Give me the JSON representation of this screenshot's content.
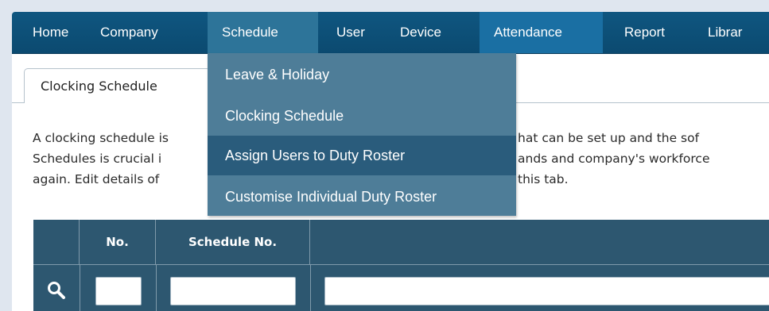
{
  "nav": {
    "items": [
      {
        "label": "Home"
      },
      {
        "label": "Company"
      },
      {
        "label": "Schedule"
      },
      {
        "label": "User"
      },
      {
        "label": "Device"
      },
      {
        "label": "Attendance"
      },
      {
        "label": "Report"
      },
      {
        "label": "Librar"
      }
    ],
    "active": "Schedule"
  },
  "dropdown": {
    "items": [
      {
        "label": "Leave & Holiday"
      },
      {
        "label": "Clocking Schedule"
      },
      {
        "label": "Assign Users to Duty Roster"
      },
      {
        "label": "Customise Individual Duty Roster"
      }
    ],
    "highlighted": "Assign Users to Duty Roster"
  },
  "tab": {
    "label": "Clocking Schedule"
  },
  "description": {
    "line1_left": "A clocking schedule is",
    "line1_right": "hat can be set up and the sof",
    "line2_left": "Schedules is crucial i",
    "line2_right": "ands and company's workforce",
    "line3_left": "again. Edit details of",
    "line3_right": "this tab."
  },
  "grid": {
    "columns": [
      {
        "label": ""
      },
      {
        "label": "No."
      },
      {
        "label": "Schedule No."
      },
      {
        "label": ""
      }
    ]
  },
  "icons": {
    "search": "search-icon"
  },
  "colors": {
    "nav_bg": "#0f5680",
    "nav_active": "#2d7499",
    "dropdown_bg": "#4e7d98",
    "dropdown_highlight": "#2a5c7c",
    "grid_header": "#2d5770"
  }
}
